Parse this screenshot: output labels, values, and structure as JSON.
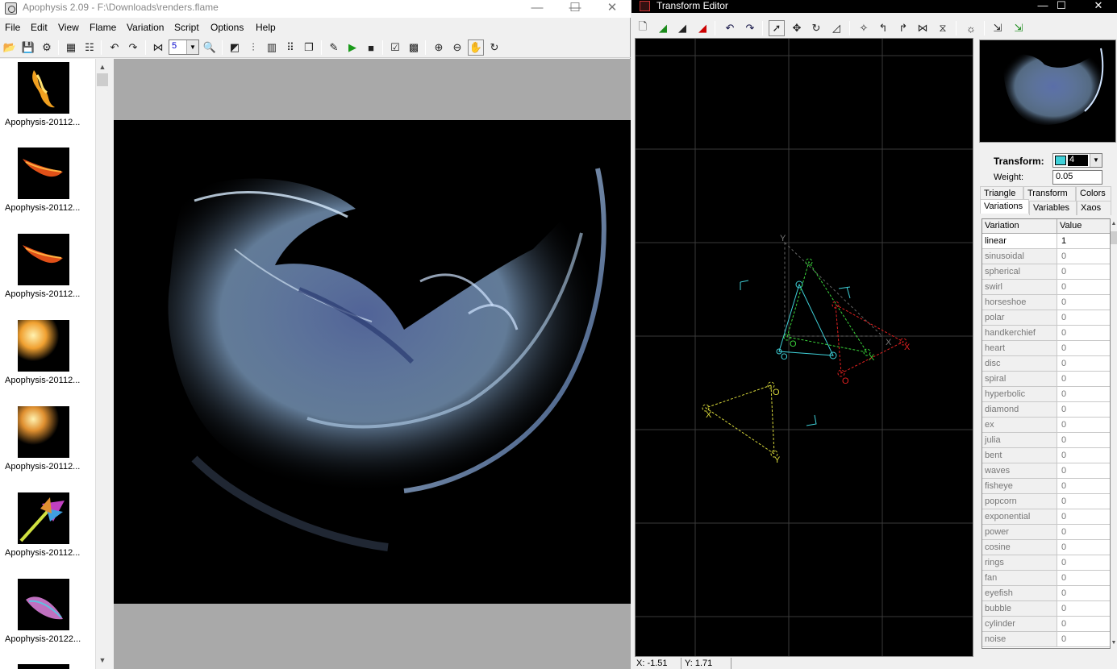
{
  "main_window": {
    "title": "Apophysis 2.09 - F:\\Downloads\\renders.flame",
    "controls": {
      "minimize": "—",
      "maximize": "☐",
      "close": "✕"
    },
    "menu": [
      "File",
      "Edit",
      "View",
      "Flame",
      "Variation",
      "Script",
      "Options",
      "Help"
    ],
    "toolbar_combo_value": "5",
    "thumbnails": [
      {
        "caption": "Apophysis-20112..."
      },
      {
        "caption": "Apophysis-20112..."
      },
      {
        "caption": "Apophysis-20112..."
      },
      {
        "caption": "Apophysis-20112..."
      },
      {
        "caption": "Apophysis-20112..."
      },
      {
        "caption": "Apophysis-20112..."
      },
      {
        "caption": "Apophysis-20122..."
      }
    ]
  },
  "editor": {
    "title": "Transform Editor",
    "controls": {
      "minimize": "—",
      "maximize": "☐",
      "close": "✕"
    },
    "transform_label": "Transform:",
    "transform_value": "4",
    "weight_label": "Weight:",
    "weight_value": "0.05",
    "tabs_row1": [
      "Triangle",
      "Transform",
      "Colors"
    ],
    "tabs_row2": [
      "Variations",
      "Variables",
      "Xaos"
    ],
    "active_tab": "Variations",
    "table_headers": {
      "name": "Variation",
      "value": "Value"
    },
    "variations": [
      {
        "name": "linear",
        "value": "1"
      },
      {
        "name": "sinusoidal",
        "value": "0"
      },
      {
        "name": "spherical",
        "value": "0"
      },
      {
        "name": "swirl",
        "value": "0"
      },
      {
        "name": "horseshoe",
        "value": "0"
      },
      {
        "name": "polar",
        "value": "0"
      },
      {
        "name": "handkerchief",
        "value": "0"
      },
      {
        "name": "heart",
        "value": "0"
      },
      {
        "name": "disc",
        "value": "0"
      },
      {
        "name": "spiral",
        "value": "0"
      },
      {
        "name": "hyperbolic",
        "value": "0"
      },
      {
        "name": "diamond",
        "value": "0"
      },
      {
        "name": "ex",
        "value": "0"
      },
      {
        "name": "julia",
        "value": "0"
      },
      {
        "name": "bent",
        "value": "0"
      },
      {
        "name": "waves",
        "value": "0"
      },
      {
        "name": "fisheye",
        "value": "0"
      },
      {
        "name": "popcorn",
        "value": "0"
      },
      {
        "name": "exponential",
        "value": "0"
      },
      {
        "name": "power",
        "value": "0"
      },
      {
        "name": "cosine",
        "value": "0"
      },
      {
        "name": "rings",
        "value": "0"
      },
      {
        "name": "fan",
        "value": "0"
      },
      {
        "name": "eyefish",
        "value": "0"
      },
      {
        "name": "bubble",
        "value": "0"
      },
      {
        "name": "cylinder",
        "value": "0"
      },
      {
        "name": "noise",
        "value": "0"
      }
    ],
    "status": {
      "x": "X: -1.51",
      "y": "Y: 1.71"
    },
    "triangle_labels": {
      "y": "Y",
      "o": "O",
      "x": "X"
    },
    "colors": {
      "cyan": "#3fd0d8",
      "green": "#3ad33a",
      "red": "#e02020",
      "yellow": "#d8d83a",
      "grid": "#3a3a3a"
    }
  }
}
